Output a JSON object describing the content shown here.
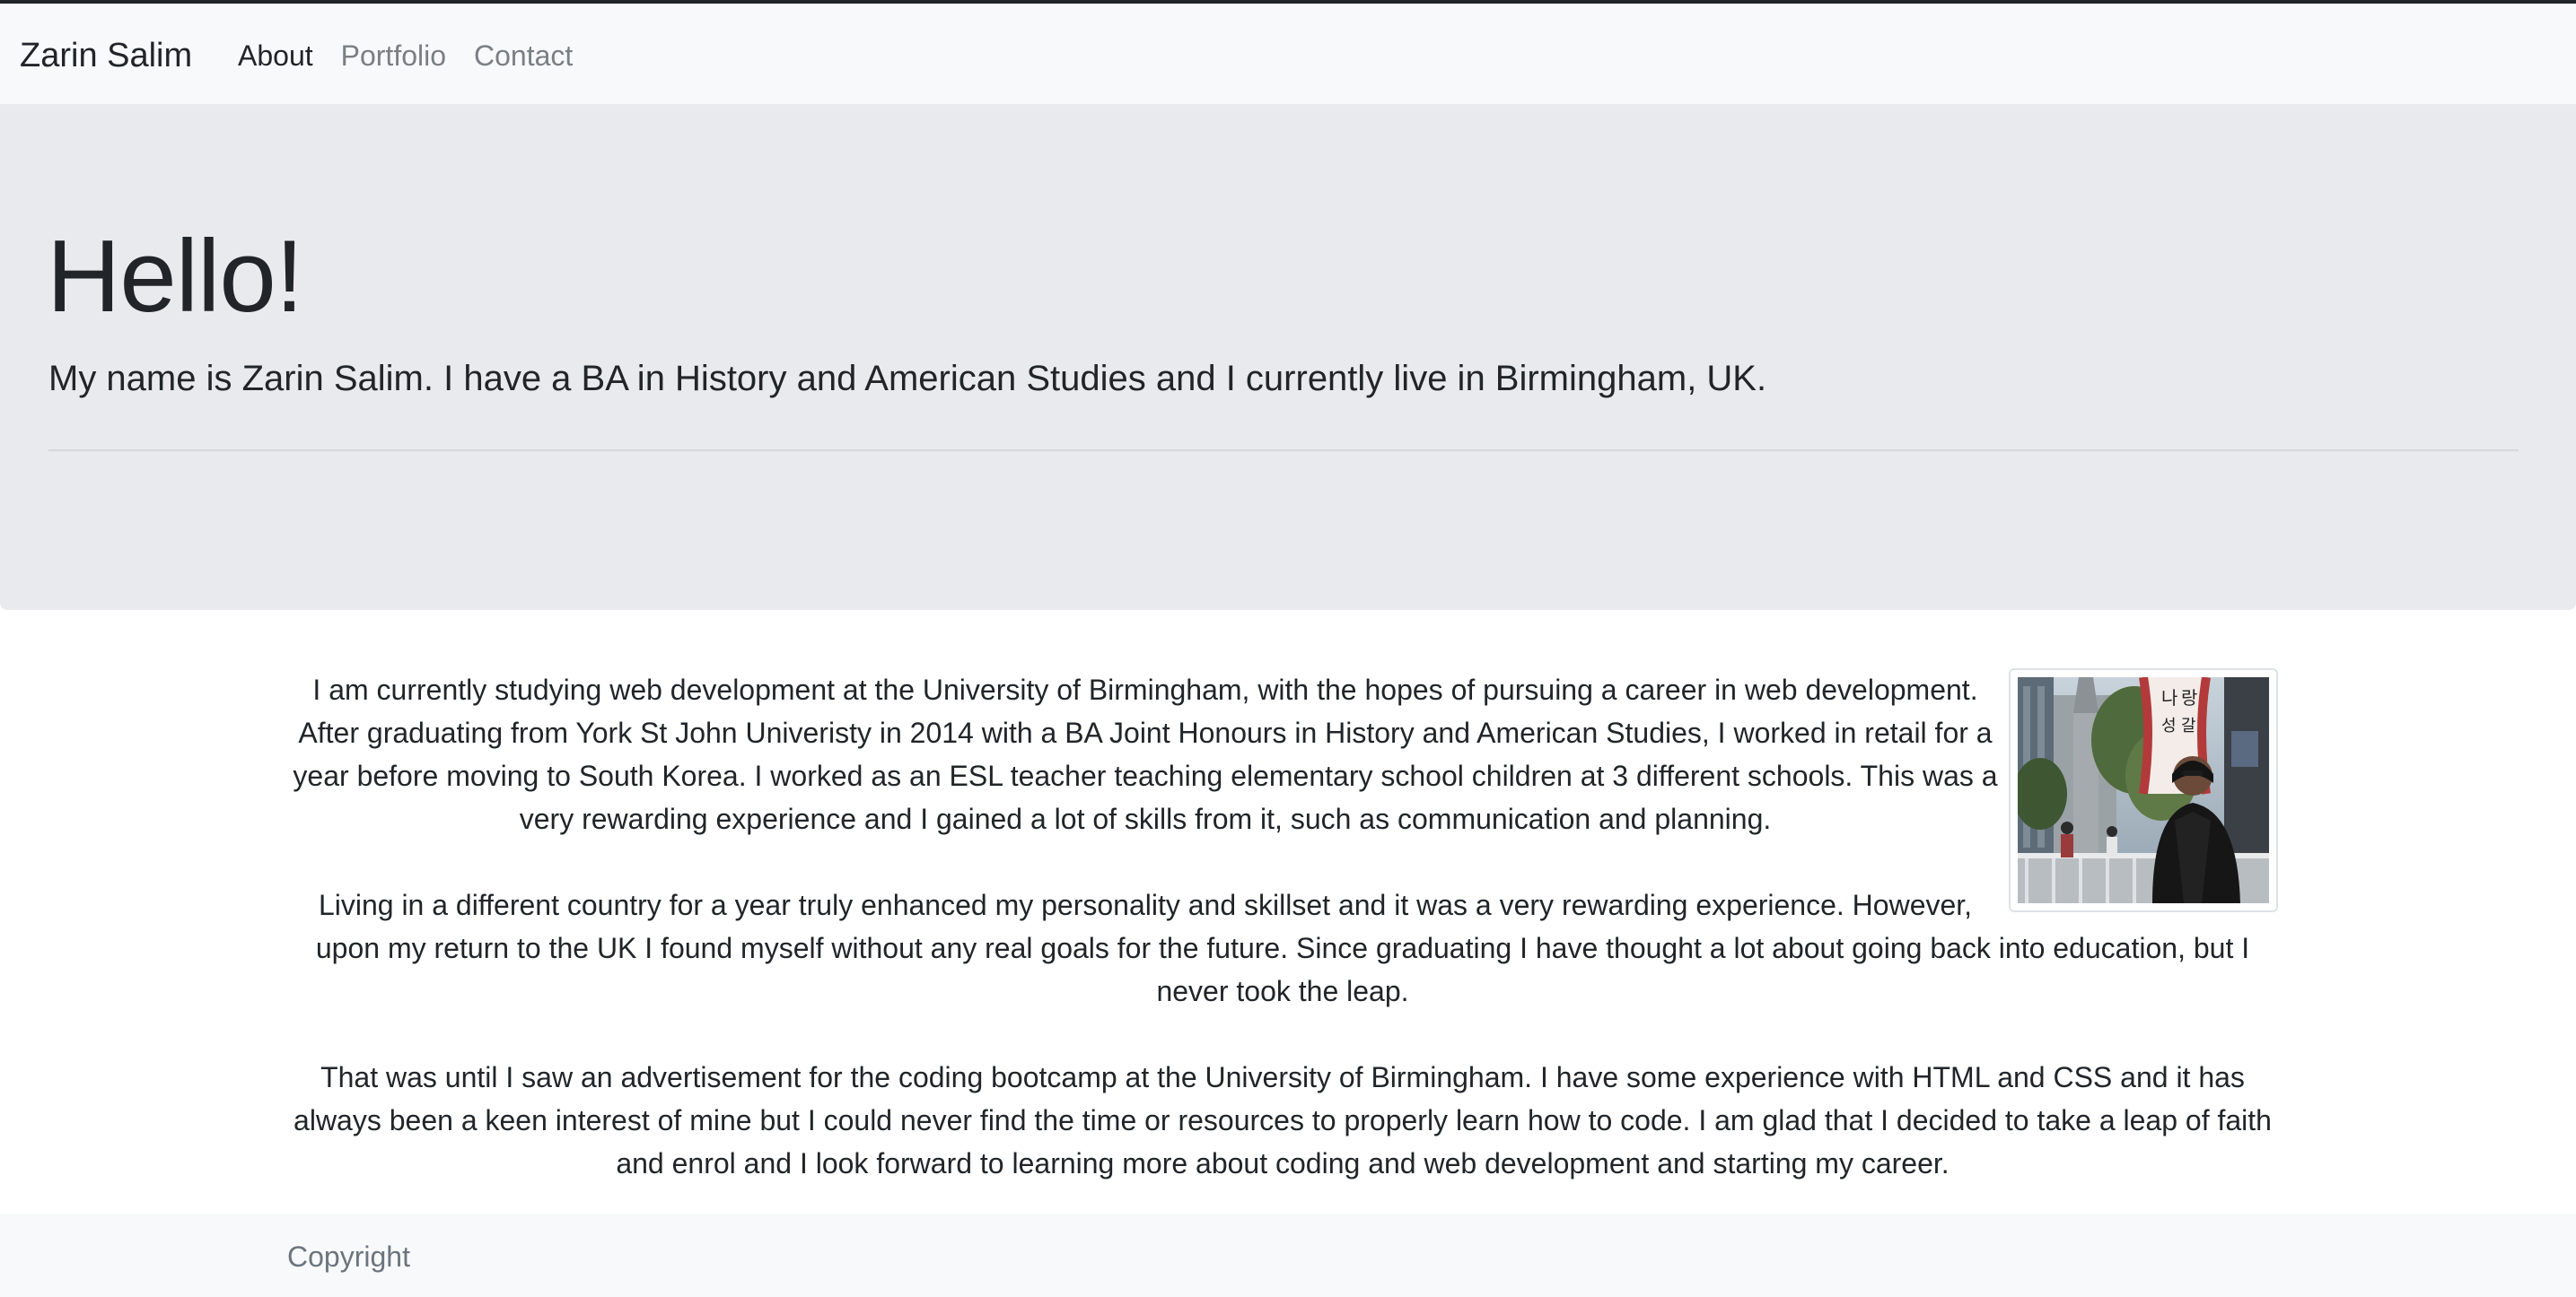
{
  "navbar": {
    "brand": "Zarin Salim",
    "links": [
      {
        "label": "About",
        "active": true
      },
      {
        "label": "Portfolio",
        "active": false
      },
      {
        "label": "Contact",
        "active": false
      }
    ]
  },
  "hero": {
    "heading": "Hello!",
    "lead": "My name is Zarin Salim. I have a BA in History and American Studies and I currently live in Birmingham, UK."
  },
  "about": {
    "paragraphs": [
      "I am currently studying web development at the University of Birmingham, with the hopes of pursuing a career in web development. After graduating from York St John Univeristy in 2014 with a BA Joint Honours in History and American Studies, I worked in retail for a year before moving to South Korea. I worked as an ESL teacher teaching elementary school children at 3 different schools. This was a very rewarding experience and I gained a lot of skills from it, such as communication and planning.",
      "Living in a different country for a year truly enhanced my personality and skillset and it was a very rewarding experience. However, upon my return to the UK I found myself without any real goals for the future. Since graduating I have thought a lot about going back into education, but I never took the leap.",
      "That was until I saw an advertisement for the coding bootcamp at the University of Birmingham. I have some experience with HTML and CSS and it has always been a keen interest of mine but I could never find the time or resources to properly learn how to code. I am glad that I decided to take a leap of faith and enrol and I look forward to learning more about coding and web development and starting my career."
    ],
    "photo_alt": "profile photo"
  },
  "footer": {
    "text": "Copyright"
  },
  "colors": {
    "navbar_bg": "#f8f9fa",
    "jumbotron_bg": "#e9eaee",
    "text": "#212529",
    "muted_link": "#7a7f84"
  }
}
